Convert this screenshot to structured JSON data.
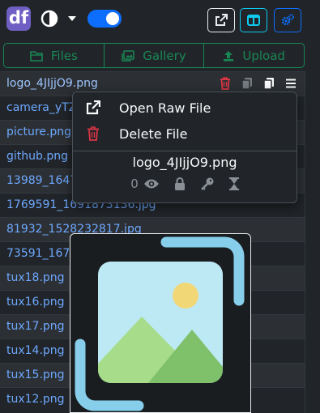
{
  "header": {
    "logo_text": "df",
    "theme_icon": "half-circle-contrast-icon",
    "dropdown_icon": "caret-down-icon",
    "toggle_state": "on",
    "buttons": [
      {
        "icon": "external-link-icon",
        "color": "#e9ecef"
      },
      {
        "icon": "columns-icon",
        "color": "#0dcaf0"
      },
      {
        "icon": "cogs-icon",
        "color": "#0d6efd"
      }
    ]
  },
  "tabs": [
    {
      "label": "Files",
      "icon": "folder-icon"
    },
    {
      "label": "Gallery",
      "icon": "image-icon"
    },
    {
      "label": "Upload",
      "icon": "upload-icon"
    }
  ],
  "files": [
    "logo_4JIjjO9.png",
    "camera_yTZ",
    "picture.png",
    "github.png",
    "13989_1647",
    "1769591_1691873136.jpg",
    "81932_1528232817.jpg",
    "73591_167",
    "tux18.png",
    "tux16.png",
    "tux17.png",
    "tux14.png",
    "tux15.png",
    "tux12.png"
  ],
  "row_tools": [
    "trash-icon",
    "copy-icon",
    "copy-icon",
    "menu-icon"
  ],
  "context_menu": {
    "open_label": "Open Raw File",
    "delete_label": "Delete File",
    "filename": "logo_4JIjjO9.png",
    "views": "0",
    "stat_icons": [
      "eye-icon",
      "lock-icon",
      "key-icon",
      "hourglass-icon"
    ]
  },
  "preview": {
    "icon": "image-placeholder-icon"
  },
  "colors": {
    "background": "#212529",
    "link": "#6ea8fe",
    "success": "#198754",
    "danger": "#dc3545",
    "info": "#0dcaf0",
    "primary": "#0d6efd",
    "logo": "#6f5fc4"
  }
}
